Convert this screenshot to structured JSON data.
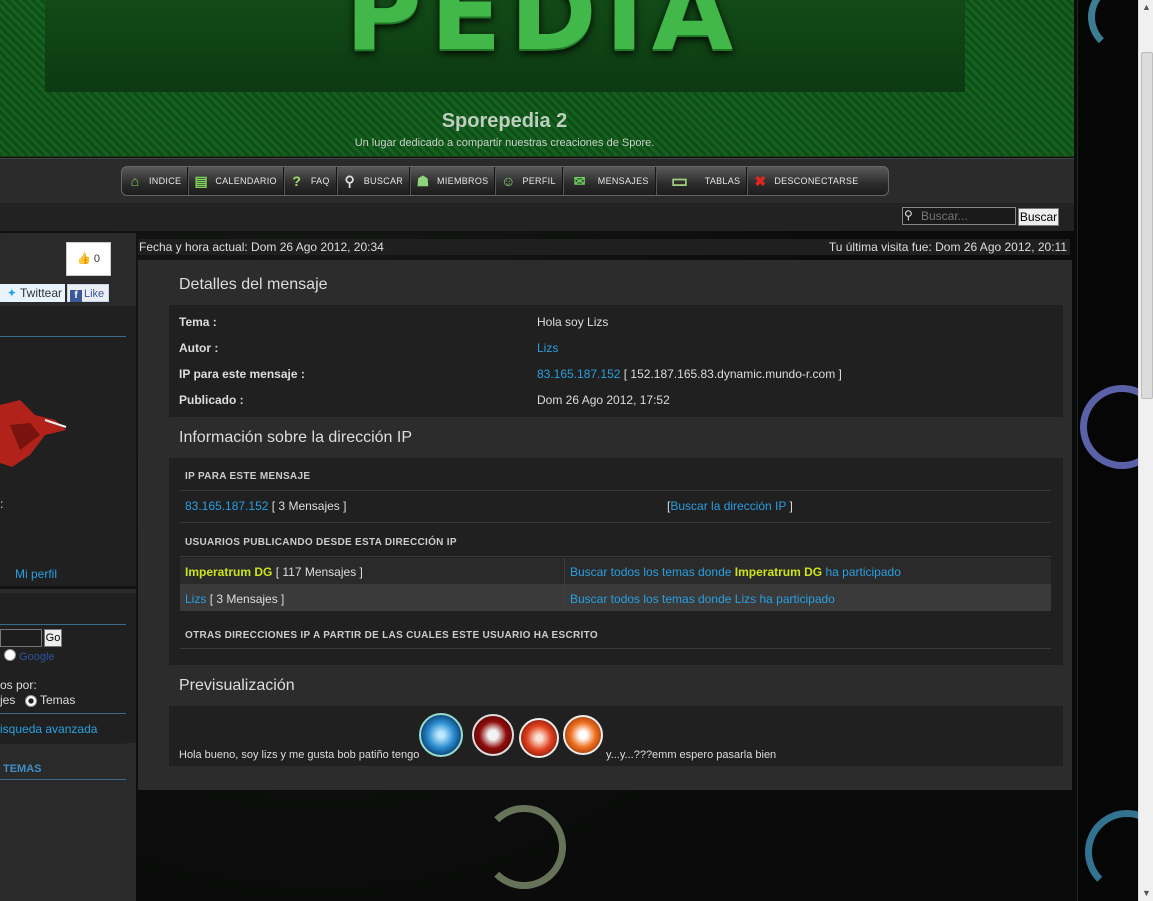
{
  "header": {
    "logo_text": "PEDIA",
    "site_title": "Sporepedia 2",
    "site_subtitle": "Un lugar dedicado a compartir nuestras creaciones de Spore."
  },
  "nav": {
    "items": [
      {
        "label": "INDICE",
        "icon": "home-icon",
        "glyph": "⌂"
      },
      {
        "label": "CALENDARIO",
        "icon": "calendar-icon",
        "glyph": "▤"
      },
      {
        "label": "FAQ",
        "icon": "question-icon",
        "glyph": "?"
      },
      {
        "label": "BUSCAR",
        "icon": "search-icon",
        "glyph": "⚲"
      },
      {
        "label": "MIEMBROS",
        "icon": "members-icon",
        "glyph": "☗"
      },
      {
        "label": "PERFIL",
        "icon": "profile-icon",
        "glyph": "☺"
      },
      {
        "label": "MENSAJES",
        "icon": "envelope-icon",
        "glyph": "✉"
      },
      {
        "label": "TABLAS",
        "icon": "tables-icon",
        "glyph": "▭"
      },
      {
        "label": "DESCONECTARSE",
        "icon": "logout-icon",
        "glyph": "✖"
      }
    ]
  },
  "search": {
    "placeholder": "Buscar...",
    "button": "Buscar"
  },
  "datebar": {
    "current": "Fecha y hora actual: Dom 26 Ago 2012, 20:34",
    "last_visit": "Tu última visita fue: Dom 26 Ago 2012, 20:11"
  },
  "sidebar": {
    "fb_count": "0",
    "twitter_label": "Twittear",
    "fb_like_label": "Like",
    "colon": ":",
    "mi_perfil": "Mi perfil",
    "go_label": "Go",
    "google_label": "Google",
    "search_by": "os por:",
    "opt_mensajes": "jes",
    "opt_temas": "Temas",
    "advanced": "isqueda avanzada",
    "temas_header": "TEMAS"
  },
  "details": {
    "heading": "Detalles del mensaje",
    "tema_label": "Tema :",
    "tema_value": "Hola soy Lizs",
    "autor_label": "Autor :",
    "autor_value": "Lizs",
    "ip_label": "IP para este mensaje :",
    "ip_value": "83.165.187.152",
    "ip_host": "[ 152.187.165.83.dynamic.mundo-r.com ]",
    "publicado_label": "Publicado :",
    "publicado_value": "Dom 26 Ago 2012, 17:52"
  },
  "ipinfo": {
    "heading": "Información sobre la dirección IP",
    "ip_section": "IP PARA ESTE MENSAJE",
    "ip": "83.165.187.152",
    "ip_count": "[ 3 Mensajes ]",
    "lookup_open": "[",
    "lookup_link": "Buscar la dirección IP",
    "lookup_close": "]",
    "users_section": "USUARIOS PUBLICANDO DESDE ESTA DIRECCIÓN IP",
    "users": [
      {
        "name": "Imperatrum DG",
        "count": "[ 117 Mensajes ]",
        "search_pre": "Buscar todos los temas donde",
        "search_name": "Imperatrum DG",
        "search_post": "ha participado"
      },
      {
        "name": "Lizs",
        "count": "[ 3 Mensajes ]",
        "search_pre": "Buscar todos los temas donde",
        "search_name": "Lizs",
        "search_post": "ha participado"
      }
    ],
    "other_section": "OTRAS DIRECCIONES IP A PARTIR DE LAS CUALES ESTE USUARIO HA ESCRITO"
  },
  "preview": {
    "heading": "Previsualización",
    "text_before": "Hola bueno, soy lizs y me gusta bob patiño tengo",
    "text_after": "y...y...???emm espero pasarla bien"
  }
}
